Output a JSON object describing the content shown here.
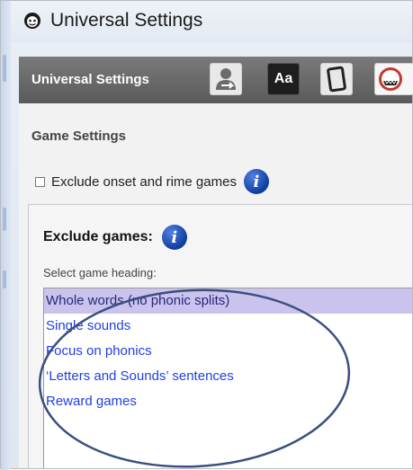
{
  "window": {
    "title": "Universal Settings",
    "app_icon": "character-face-icon"
  },
  "tabbar": {
    "label": "Universal Settings",
    "tabs": [
      {
        "name": "user-switch",
        "icon": "user-switch-icon"
      },
      {
        "name": "font",
        "icon": "font-icon",
        "label": "Aa"
      },
      {
        "name": "device",
        "icon": "device-card-icon"
      },
      {
        "name": "games",
        "icon": "game-character-icon"
      }
    ]
  },
  "game_settings": {
    "title": "Game Settings",
    "exclude_onset_label": "Exclude onset and rime games",
    "exclude_onset_checked": false
  },
  "exclude_games": {
    "heading": "Exclude games:",
    "select_label": "Select game heading:",
    "items": [
      "Whole words (no phonic splits)",
      "Single sounds",
      "Focus on phonics",
      "‘Letters and Sounds’ sentences",
      "Reward games"
    ],
    "selected_index": 0
  },
  "colors": {
    "tabbar_bg": "#666666",
    "link_blue": "#1f3fe0",
    "selected_bg": "#c9c3ee",
    "callout_stroke": "#3a4f80",
    "info_blue": "#0e3d9e"
  }
}
